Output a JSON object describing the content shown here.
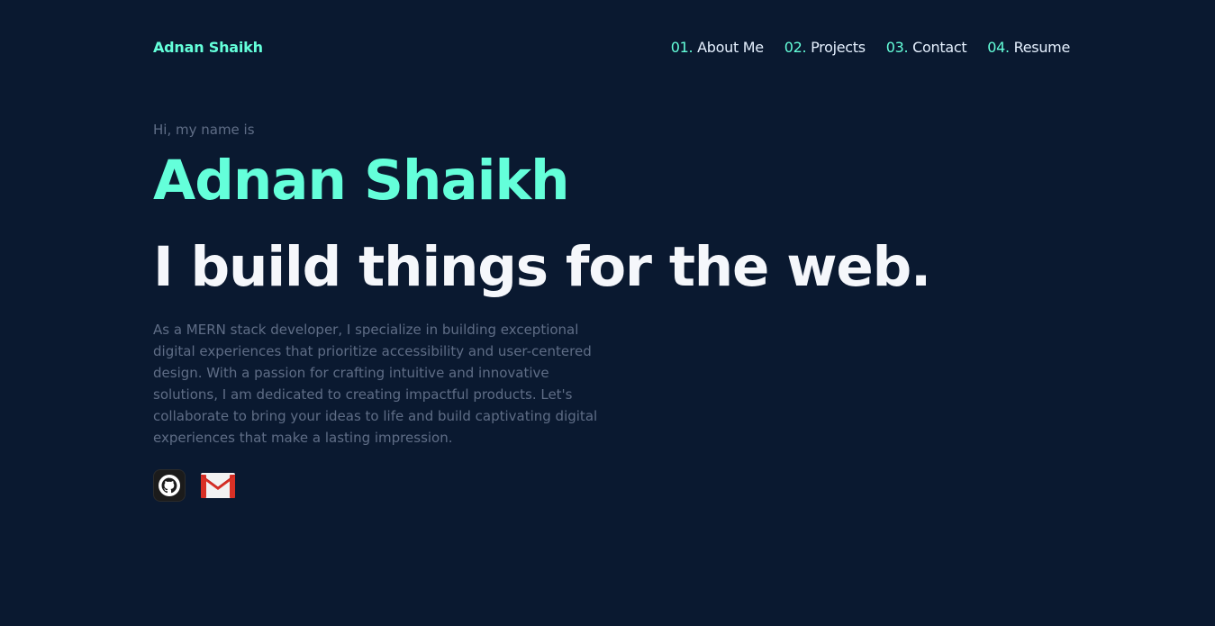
{
  "header": {
    "logo": "Adnan Shaikh",
    "nav": [
      {
        "num": "01.",
        "label": "About Me"
      },
      {
        "num": "02.",
        "label": "Projects"
      },
      {
        "num": "03.",
        "label": "Contact"
      },
      {
        "num": "04.",
        "label": "Resume"
      }
    ]
  },
  "hero": {
    "greeting": "Hi, my name is",
    "name": "Adnan Shaikh",
    "tagline": "I build things for the web.",
    "bio": "As a MERN stack developer, I specialize in building exceptional digital experiences that prioritize accessibility and user-centered design. With a passion for crafting intuitive and innovative solutions, I am dedicated to creating impactful products. Let's collaborate to bring your ideas to life and build captivating digital experiences that make a lasting impression."
  },
  "socials": [
    {
      "icon": "github-icon"
    },
    {
      "icon": "gmail-icon"
    }
  ],
  "colors": {
    "background": "#0a1930",
    "accent": "#64ffda",
    "heading": "#f5f7fb",
    "muted": "#5f6d86"
  }
}
